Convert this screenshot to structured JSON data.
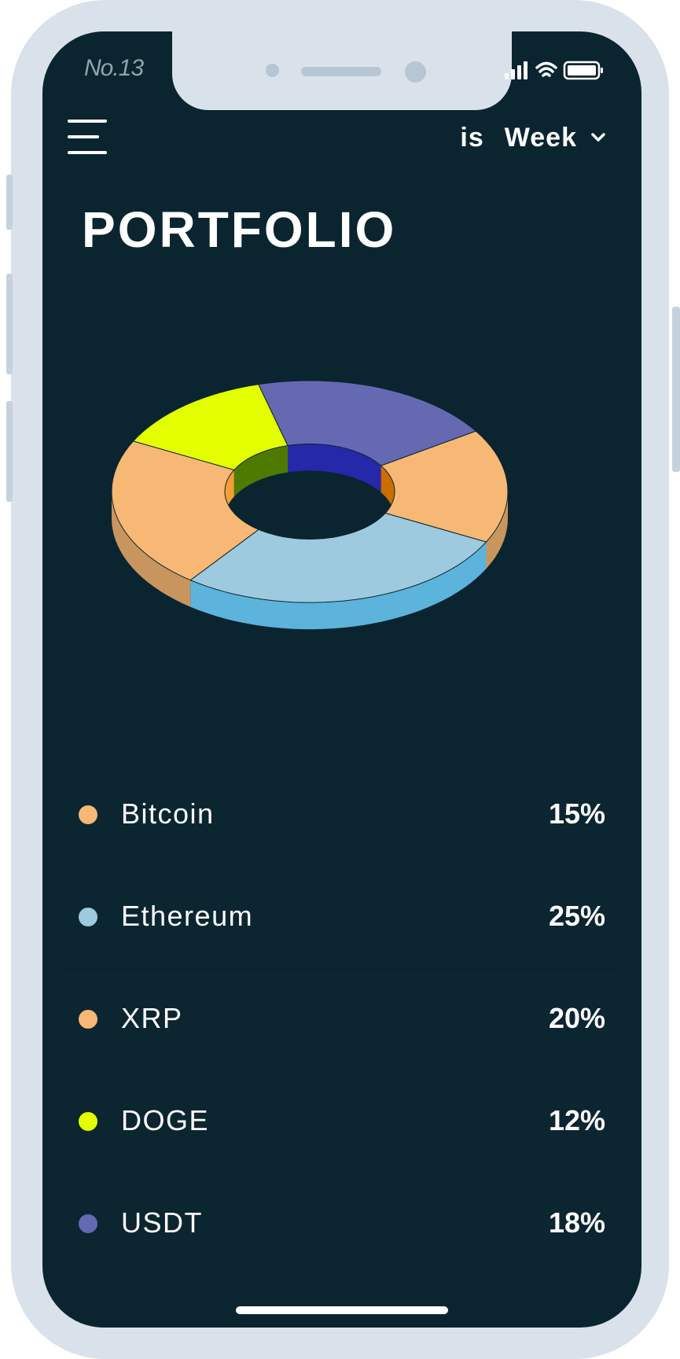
{
  "status_bar": {
    "label": "No.13"
  },
  "header": {
    "period_prefix": "is",
    "period_value": "Week"
  },
  "page_title": "PORTFOLIO",
  "colors": {
    "background": "#0a2530",
    "frame": "#d9e2ea",
    "bitcoin": "#f6b874",
    "ethereum": "#9ecadf",
    "xrp": "#f6b874",
    "doge": "#e3ff00",
    "usdt": "#6569b2"
  },
  "icons": [
    "menu-icon",
    "chevron-down-icon",
    "signal-icon",
    "wifi-icon",
    "battery-icon"
  ],
  "chart_data": {
    "type": "pie",
    "style": "3d-donut",
    "title": "",
    "categories": [
      "Bitcoin",
      "Ethereum",
      "XRP",
      "DOGE",
      "USDT"
    ],
    "values": [
      15,
      25,
      20,
      12,
      18
    ],
    "legend": "below"
  },
  "portfolio": [
    {
      "name": "Bitcoin",
      "percent": "15%",
      "color": "#f6b874"
    },
    {
      "name": "Ethereum",
      "percent": "25%",
      "color": "#9ecadf"
    },
    {
      "name": "XRP",
      "percent": "20%",
      "color": "#f6b874"
    },
    {
      "name": "DOGE",
      "percent": "12%",
      "color": "#e3ff00"
    },
    {
      "name": "USDT",
      "percent": "18%",
      "color": "#6569b2"
    }
  ]
}
